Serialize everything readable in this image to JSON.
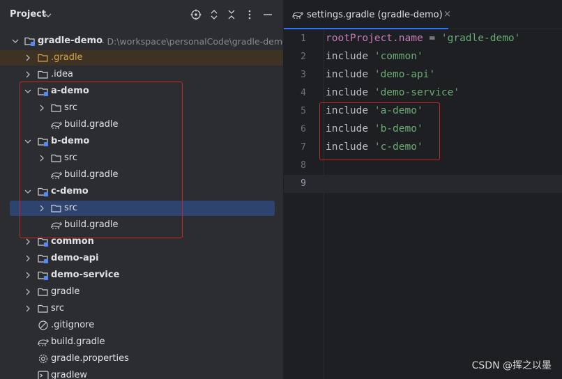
{
  "project_panel": {
    "title": "Project",
    "header_icons": [
      "locate-icon",
      "expand-collapse-icon",
      "collapse-all-icon",
      "more-vertical-icon",
      "minimize-icon"
    ],
    "root": {
      "label": "gradle-demo",
      "path": "- D:\\workspace\\personalCode\\gradle-demo"
    },
    "tree": [
      {
        "label": ".gradle"
      },
      {
        "label": ".idea"
      },
      {
        "label": "a-demo"
      },
      {
        "label": "src"
      },
      {
        "label": "build.gradle"
      },
      {
        "label": "b-demo"
      },
      {
        "label": "src"
      },
      {
        "label": "build.gradle"
      },
      {
        "label": "c-demo"
      },
      {
        "label": "src"
      },
      {
        "label": "build.gradle"
      },
      {
        "label": "common"
      },
      {
        "label": "demo-api"
      },
      {
        "label": "demo-service"
      },
      {
        "label": "gradle"
      },
      {
        "label": "src"
      },
      {
        "label": ".gitignore"
      },
      {
        "label": "build.gradle"
      },
      {
        "label": "gradle.properties"
      },
      {
        "label": "gradlew"
      }
    ]
  },
  "editor": {
    "tab": {
      "label": "settings.gradle (gradle-demo)",
      "close": "×"
    },
    "lines": [
      {
        "n": "1",
        "k1": "rootProject",
        "k2": ".name",
        "eq": " = ",
        "s": "'gradle-demo'"
      },
      {
        "n": "2",
        "kw": "include ",
        "s": "'common'"
      },
      {
        "n": "3",
        "kw": "include ",
        "s": "'demo-api'"
      },
      {
        "n": "4",
        "kw": "include ",
        "s": "'demo-service'"
      },
      {
        "n": "5",
        "kw": "include ",
        "s": "'a-demo'"
      },
      {
        "n": "6",
        "kw": "include ",
        "s": "'b-demo'"
      },
      {
        "n": "7",
        "kw": "include ",
        "s": "'c-demo'"
      },
      {
        "n": "8"
      },
      {
        "n": "9"
      }
    ]
  },
  "watermark": "CSDN @挥之以墨",
  "colors": {
    "panel_bg": "#2b2d30",
    "editor_bg": "#1e1f22",
    "selection": "#2e436e",
    "annotation": "#c9272d",
    "string": "#6aab73",
    "property": "#c77dbb",
    "folder_excluded": "#d5a449"
  }
}
